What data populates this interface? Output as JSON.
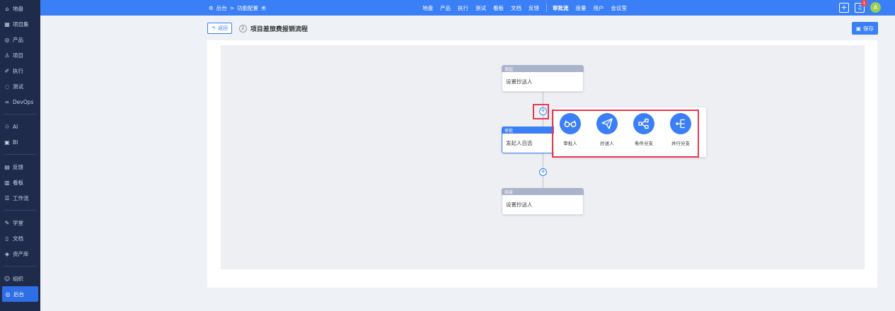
{
  "sidebar": {
    "items": [
      {
        "icon": "home-icon",
        "glyph": "⌂",
        "label": "地盘"
      },
      {
        "icon": "grid-icon",
        "glyph": "▦",
        "label": "项目集"
      },
      {
        "icon": "product-icon",
        "glyph": "◎",
        "label": "产品"
      },
      {
        "icon": "project-icon",
        "glyph": "♙",
        "label": "项目"
      },
      {
        "icon": "execute-icon",
        "glyph": "✐",
        "label": "执行"
      },
      {
        "icon": "test-icon",
        "glyph": "◌",
        "label": "测试"
      },
      {
        "icon": "devops-icon",
        "glyph": "∞",
        "label": "DevOps"
      },
      {
        "icon": "ai-icon",
        "glyph": "♲",
        "label": "AI"
      },
      {
        "icon": "bi-icon",
        "glyph": "▣",
        "label": "BI"
      },
      {
        "icon": "feedback-icon",
        "glyph": "▤",
        "label": "反馈"
      },
      {
        "icon": "board-icon",
        "glyph": "▥",
        "label": "看板"
      },
      {
        "icon": "workflow-icon",
        "glyph": "☰",
        "label": "工作流"
      },
      {
        "icon": "learn-icon",
        "glyph": "✎",
        "label": "学堂"
      },
      {
        "icon": "doc-icon",
        "glyph": "▯",
        "label": "文档"
      },
      {
        "icon": "asset-icon",
        "glyph": "◈",
        "label": "资产库"
      },
      {
        "icon": "org-icon",
        "glyph": "☺",
        "label": "组织"
      },
      {
        "icon": "admin-icon",
        "glyph": "◎",
        "label": "后台"
      }
    ]
  },
  "topbar": {
    "breadcrumb_icon": "gear-icon",
    "breadcrumb_root": "后台",
    "breadcrumb_sep": ">",
    "breadcrumb_current": "功能配置",
    "nav": [
      "地盘",
      "产品",
      "执行",
      "测试",
      "看板",
      "文档",
      "反馈"
    ],
    "nav2": [
      "审批流",
      "度量",
      "用户",
      "会议室"
    ],
    "active_nav": "审批流",
    "bell_badge": "1",
    "avatar_letter": "A"
  },
  "header": {
    "back_label": "返回",
    "step": "2",
    "title": "项目差旅费报销流程",
    "save_label": "保存"
  },
  "flow": {
    "start": {
      "header": "发起",
      "body": "设置抄送人"
    },
    "approve": {
      "header": "审批",
      "body": "发起人自选"
    },
    "end": {
      "header": "结束",
      "body": "设置抄送人"
    }
  },
  "popup": {
    "options": [
      {
        "icon": "glasses-icon",
        "label": "审批人"
      },
      {
        "icon": "send-icon",
        "label": "抄送人"
      },
      {
        "icon": "branch-icon",
        "label": "条件分支"
      },
      {
        "icon": "parallel-icon",
        "label": "并行分支"
      }
    ]
  },
  "colors": {
    "primary": "#3a7ff5",
    "sidebar": "#1e2b4a",
    "highlight": "#e8384f",
    "canvas": "#eeeff3"
  }
}
